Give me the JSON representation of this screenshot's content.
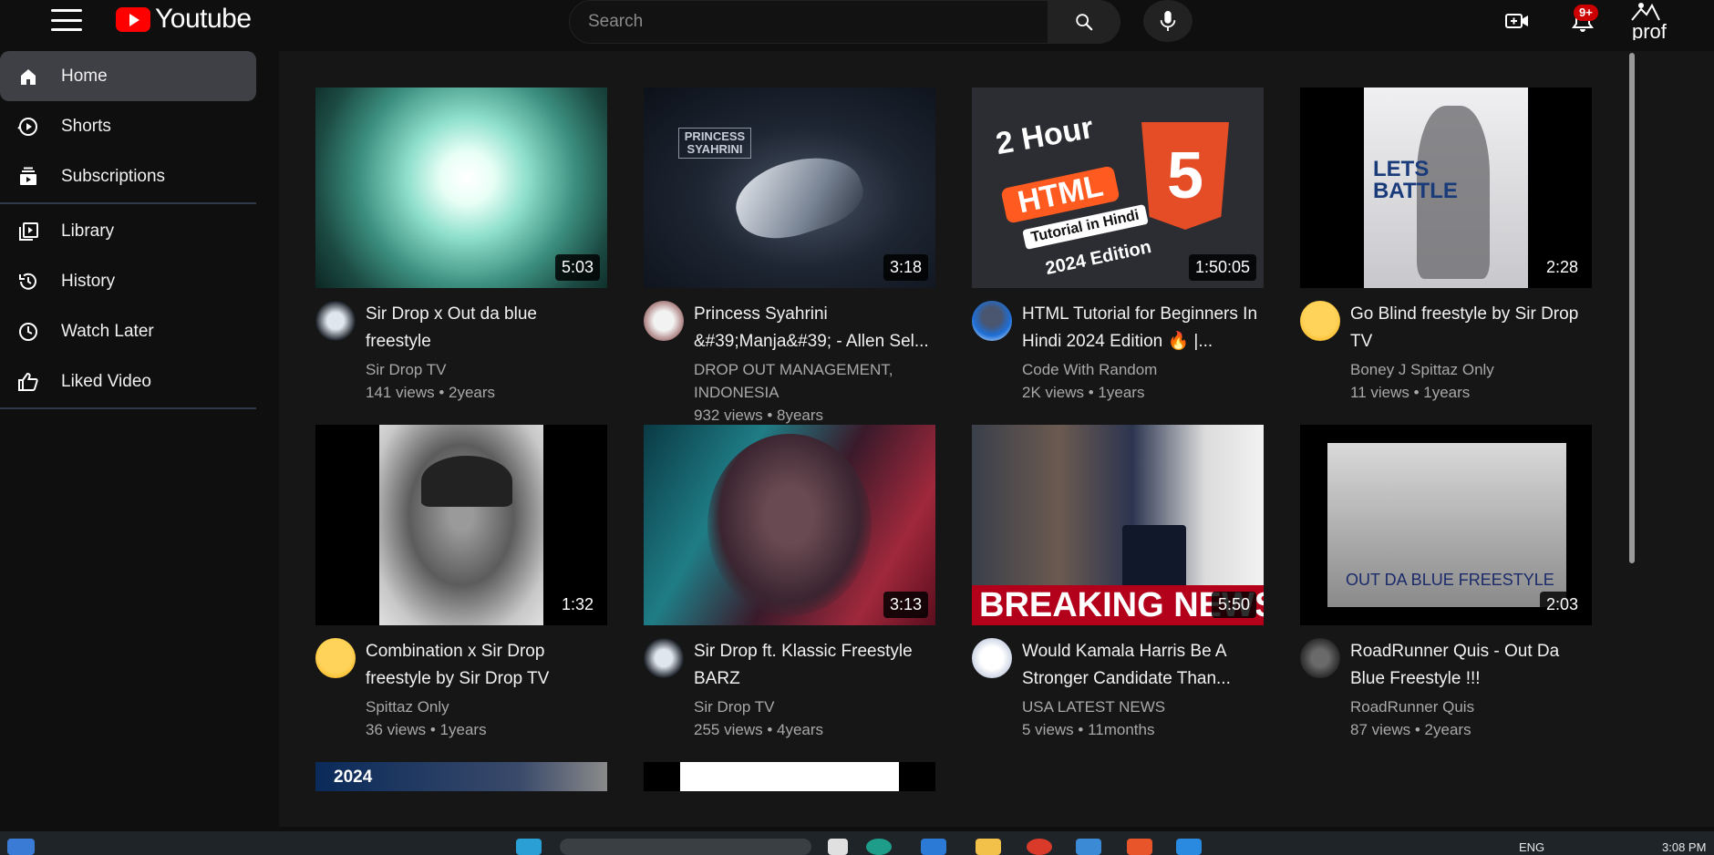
{
  "app": {
    "logo_text": "Youtube"
  },
  "search": {
    "placeholder": "Search"
  },
  "header": {
    "notification_badge": "9+",
    "profile_text": "prof"
  },
  "sidebar": {
    "items": [
      {
        "label": "Home",
        "icon": "home-icon",
        "active": true
      },
      {
        "label": "Shorts",
        "icon": "shorts-icon"
      },
      {
        "label": "Subscriptions",
        "icon": "subscriptions-icon"
      },
      {
        "label": "Library",
        "icon": "library-icon"
      },
      {
        "label": "History",
        "icon": "history-icon"
      },
      {
        "label": "Watch Later",
        "icon": "watch-later-icon"
      },
      {
        "label": "Liked Video",
        "icon": "liked-video-icon"
      }
    ]
  },
  "videos": [
    {
      "title": "Sir Drop x Out da blue freestyle",
      "channel": "Sir Drop TV",
      "stats": "141 views • 2years",
      "duration": "5:03"
    },
    {
      "title": "Princess Syahrini &#39;Manja&#39; - Allen Sel...",
      "channel": "DROP OUT MANAGEMENT, INDONESIA",
      "stats": "932 views • 8years",
      "duration": "3:18",
      "thumb_text": "PRINCESS SYAHRINI"
    },
    {
      "title": "HTML Tutorial for Beginners In Hindi 2024 Edition 🔥 |...",
      "channel": "Code With Random",
      "stats": "2K views • 1years",
      "duration": "1:50:05",
      "thumb_text": {
        "hour": "2 Hour",
        "html": "HTML",
        "tutorial": "Tutorial in Hindi",
        "edition": "2024 Edition",
        "five": "5"
      }
    },
    {
      "title": "Go Blind freestyle by Sir Drop TV",
      "channel": "Boney J Spittaz Only",
      "stats": "11 views • 1years",
      "duration": "2:28",
      "thumb_text": "LETS BATTLE"
    },
    {
      "title": "Combination x Sir Drop freestyle by Sir Drop TV",
      "channel": "Spittaz Only",
      "stats": "36 views • 1years",
      "duration": "1:32"
    },
    {
      "title": "Sir Drop ft. Klassic Freestyle BARZ",
      "channel": "Sir Drop TV",
      "stats": "255 views • 4years",
      "duration": "3:13"
    },
    {
      "title": "Would Kamala Harris Be A Stronger Candidate Than...",
      "channel": "USA LATEST NEWS",
      "stats": "5 views • 11months",
      "duration": "5:50",
      "thumb_text": "BREAKING NEWS"
    },
    {
      "title": "RoadRunner Quis - Out Da Blue Freestyle !!!",
      "channel": "RoadRunner Quis",
      "stats": "87 views • 2years",
      "duration": "2:03",
      "thumb_text": "OUT DA BLUE FREESTYLE"
    }
  ],
  "partial_row": [
    {
      "thumb_text": "2024"
    },
    {
      "thumb_text": ""
    }
  ],
  "taskbar": {
    "language": "ENG",
    "time": "3:08 PM"
  },
  "colors": {
    "background": "#0f0f0f",
    "content": "#161616",
    "brand_red": "#ff0000",
    "badge_red": "#cc0000",
    "active_item": "#3f3f46"
  }
}
